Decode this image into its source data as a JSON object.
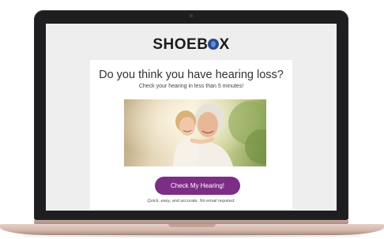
{
  "brand": {
    "logo_prefix": "SHOEB",
    "logo_suffix": "X",
    "logo_mark_icon": "hearing-aid-o-mark",
    "colors": {
      "accent": "#7d2d86",
      "logo_blue": "#2b4a8f"
    }
  },
  "hero": {
    "headline": "Do you think you have hearing loss?",
    "subheadline": "Check your hearing in less than 5 minutes!",
    "photo_alt": "Grandmother hugging smiling child outdoors"
  },
  "cta": {
    "label": "Check My Hearing!"
  },
  "footer": {
    "fine_print": "Quick, easy, and accurate. No email required."
  }
}
